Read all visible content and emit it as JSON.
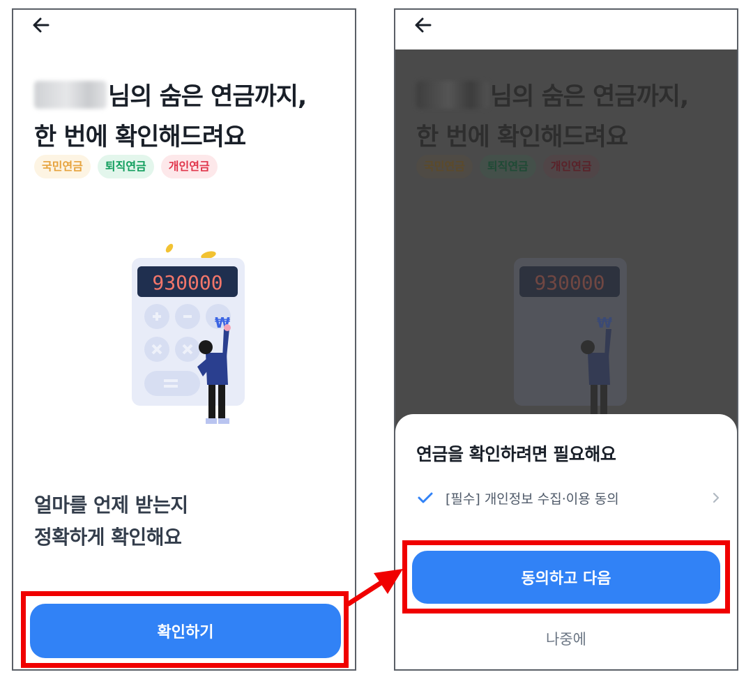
{
  "left_screen": {
    "title_suffix": "님의 숨은 연금까지,",
    "title_line2": "한 번에 확인해드려요",
    "chips": [
      {
        "label": "국민연금",
        "color": "#e6a23c",
        "bg": "#fdf4e3"
      },
      {
        "label": "퇴직연금",
        "color": "#0f9d5c",
        "bg": "#e3f6ec"
      },
      {
        "label": "개인연금",
        "color": "#e0344a",
        "bg": "#fde8ea"
      }
    ],
    "calculator_display": "930000",
    "currency_symbol": "₩",
    "subtitle_line1": "얼마를 언제 받는지",
    "subtitle_line2": "정확하게 확인해요",
    "confirm_button": "확인하기"
  },
  "right_screen": {
    "sheet_title": "연금을 확인하려면 필요해요",
    "consent_item": "[필수] 개인정보 수집·이용 동의",
    "consent_checked": true,
    "agree_button": "동의하고 다음",
    "later_button": "나중에"
  },
  "colors": {
    "primary": "#3182f6",
    "highlight": "#f00000",
    "dim_overlay": "#4a4a4a"
  },
  "icons": {
    "back": "arrow-left-icon",
    "check": "check-icon",
    "chevron": "chevron-right-icon"
  }
}
